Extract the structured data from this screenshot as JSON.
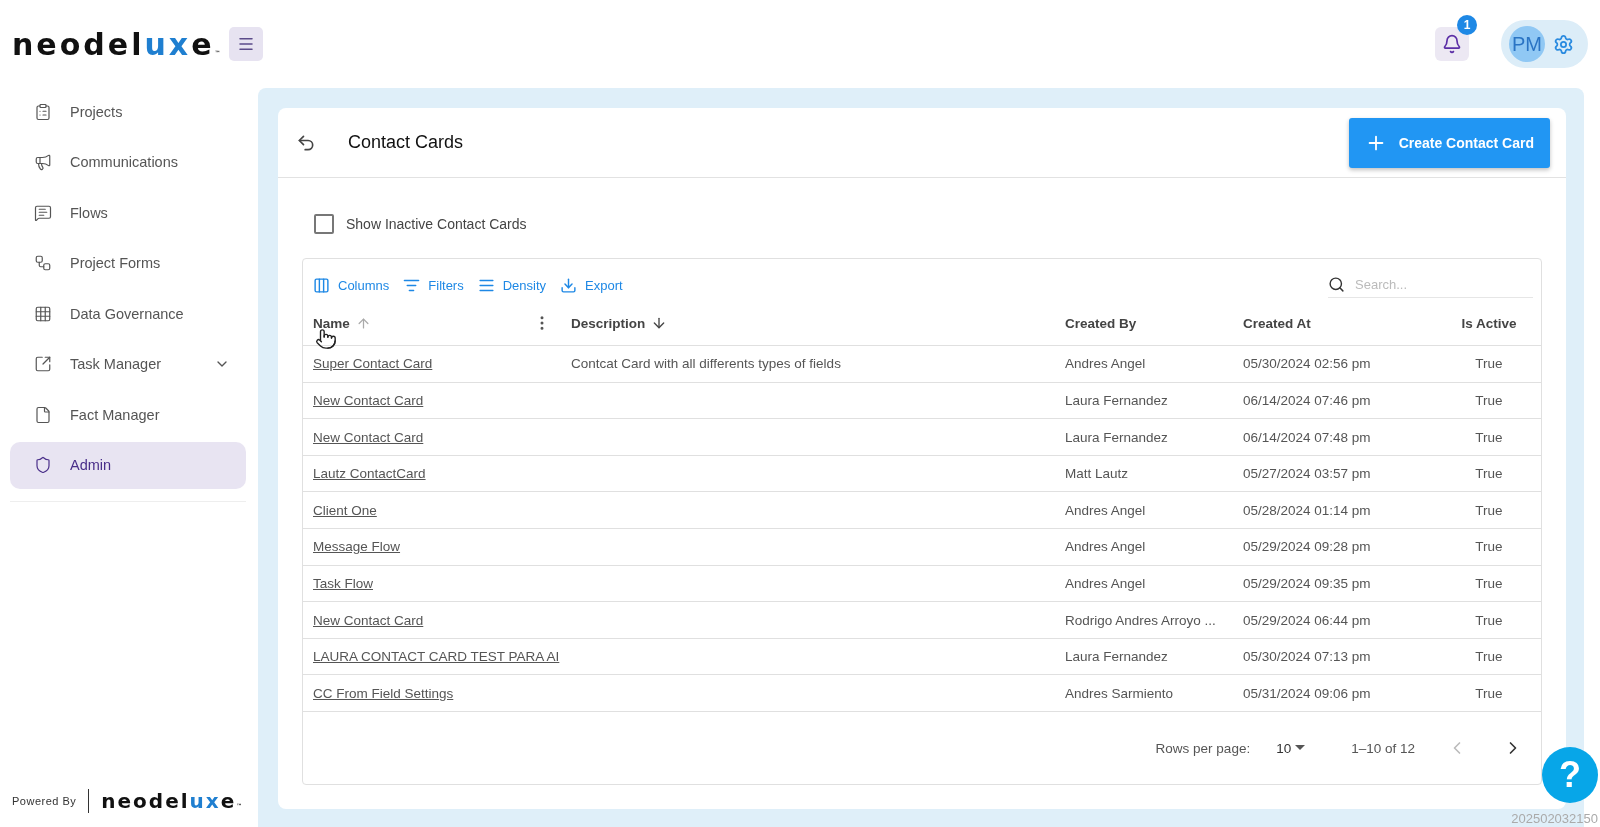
{
  "logo": {
    "parts": [
      {
        "text": "neodel",
        "accent": false
      },
      {
        "text": "ux",
        "accent": true
      },
      {
        "text": "e",
        "accent": false
      }
    ],
    "mark": "™"
  },
  "header": {
    "notifications": "1",
    "avatar": "PM"
  },
  "sidebar": {
    "items": [
      {
        "label": "Projects",
        "selected": false,
        "expandable": false
      },
      {
        "label": "Communications",
        "selected": false,
        "expandable": false
      },
      {
        "label": "Flows",
        "selected": false,
        "expandable": false
      },
      {
        "label": "Project Forms",
        "selected": false,
        "expandable": false
      },
      {
        "label": "Data Governance",
        "selected": false,
        "expandable": false
      },
      {
        "label": "Task Manager",
        "selected": false,
        "expandable": true
      },
      {
        "label": "Fact Manager",
        "selected": false,
        "expandable": false
      },
      {
        "label": "Admin",
        "selected": true,
        "expandable": false
      }
    ],
    "powered_by": "Powered By",
    "footer_logo": {
      "parts": [
        {
          "text": "neodel",
          "accent": false
        },
        {
          "text": "ux",
          "accent": true
        },
        {
          "text": "e",
          "accent": false
        }
      ],
      "mark": "™"
    }
  },
  "page": {
    "title": "Contact Cards",
    "create_button": "Create Contact Card",
    "show_inactive": {
      "label": "Show Inactive Contact Cards",
      "checked": false
    }
  },
  "toolbar": [
    {
      "label": "Columns"
    },
    {
      "label": "Filters"
    },
    {
      "label": "Density"
    },
    {
      "label": "Export"
    }
  ],
  "search": {
    "placeholder": "Search..."
  },
  "table": {
    "columns": [
      {
        "label": "Name",
        "kind": "ascending"
      },
      {
        "label": "Description",
        "kind": "descending"
      },
      {
        "label": "Created By",
        "kind": "plain"
      },
      {
        "label": "Created At",
        "kind": "plain"
      },
      {
        "label": "Is Active",
        "kind": "plain"
      }
    ],
    "rows": [
      [
        "Super Contact Card",
        "Contcat Card with all differents types of fields",
        "Andres Angel",
        "05/30/2024 02:56 pm",
        "True"
      ],
      [
        "New Contact Card",
        "",
        "Laura Fernandez",
        "06/14/2024 07:46 pm",
        "True"
      ],
      [
        "New Contact Card",
        "",
        "Laura Fernandez",
        "06/14/2024 07:48 pm",
        "True"
      ],
      [
        "Lautz ContactCard",
        "",
        "Matt Lautz",
        "05/27/2024 03:57 pm",
        "True"
      ],
      [
        "Client One",
        "",
        "Andres Angel",
        "05/28/2024 01:14 pm",
        "True"
      ],
      [
        "Message Flow",
        "",
        "Andres Angel",
        "05/29/2024 09:28 pm",
        "True"
      ],
      [
        "Task Flow",
        "",
        "Andres Angel",
        "05/29/2024 09:35 pm",
        "True"
      ],
      [
        "New Contact Card",
        "",
        "Rodrigo Andres Arroyo ...",
        "05/29/2024 06:44 pm",
        "True"
      ],
      [
        "LAURA CONTACT CARD TEST PARA AI",
        "",
        "Laura Fernandez",
        "05/30/2024 07:13 pm",
        "True"
      ],
      [
        "CC From Field Settings",
        "",
        "Andres Sarmiento",
        "05/31/2024 09:06 pm",
        "True"
      ]
    ]
  },
  "pagination": {
    "rows_per_page_label": "Rows per page:",
    "rows_per_page": "10",
    "range": "1–10 of 12",
    "prev_disabled": true,
    "next_disabled": false
  },
  "help": "?",
  "timestamp": "202502032150"
}
